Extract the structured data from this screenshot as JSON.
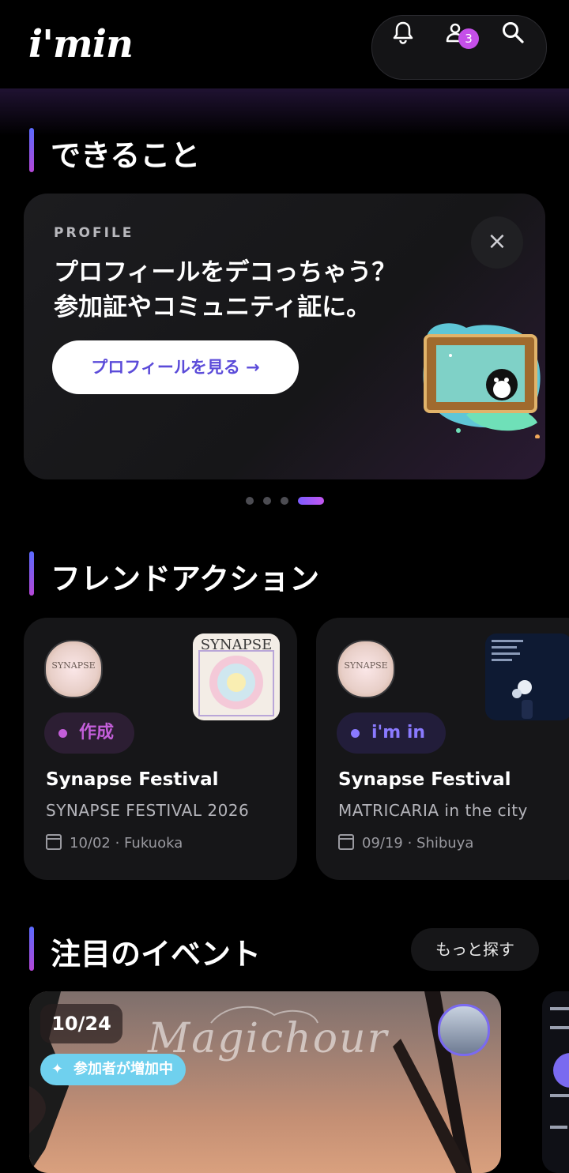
{
  "header": {
    "logo": "i'min",
    "badge_count": "3"
  },
  "promo_section": {
    "title": "できること",
    "card": {
      "label": "PROFILE",
      "text": "プロフィールをデコっちゃう？\n参加証やコミュニティ証に。",
      "button": "プロフィールを見る →",
      "close": "×"
    },
    "pager": {
      "count": 4,
      "active_index": 3
    }
  },
  "friend_section": {
    "title": "フレンドアクション",
    "cards": [
      {
        "avatar_text": "SYNAPSE",
        "chip": "作成",
        "title": "Synapse Festival",
        "subtitle": "SYNAPSE FESTIVAL 2026",
        "meta": "10/02 · Fukuoka"
      },
      {
        "avatar_text": "SYNAPSE",
        "chip": "i'm in",
        "title": "Synapse Festival",
        "subtitle": "MATRICARIA in the city",
        "meta": "09/19 · Shibuya"
      }
    ]
  },
  "events_section": {
    "title": "注目のイベント",
    "more_button": "もっと探す",
    "events": [
      {
        "date": "10/24",
        "growth_label": "参加者が増加中",
        "title_art": "Magichour"
      }
    ]
  },
  "colors": {
    "accent_purple": "#c456f0",
    "accent_blue": "#5b6bff",
    "growth_chip": "#6fd0ee"
  }
}
